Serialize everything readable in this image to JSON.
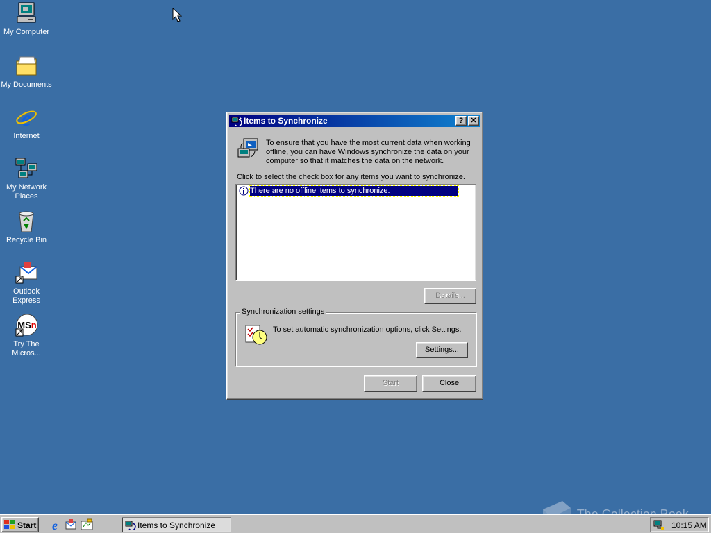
{
  "desktop": {
    "icons": [
      {
        "label": "My Computer"
      },
      {
        "label": "My Documents"
      },
      {
        "label": "Internet"
      },
      {
        "label": "My Network Places"
      },
      {
        "label": "Recycle Bin"
      },
      {
        "label": "Outlook Express"
      },
      {
        "label": "Try The Micros..."
      }
    ],
    "background_color": "#3a6ea5"
  },
  "dialog": {
    "title": "Items to Synchronize",
    "help_button": "?",
    "close_button": "✕",
    "description": "To ensure that you have the most current data when working offline, you can have Windows synchronize the data on your computer so that it matches the data on the network.",
    "instruction": "Click to select the check box for any items you want to synchronize.",
    "list_items": [
      {
        "label": "There are no offline items to synchronize.",
        "selected": true
      }
    ],
    "details_button": "Details...",
    "group": {
      "title": "Synchronization settings",
      "text": "To set automatic synchronization options, click Settings.",
      "settings_button": "Settings..."
    },
    "start_button": "Start",
    "close_label": "Close"
  },
  "taskbar": {
    "start_label": "Start",
    "task_label": "Items to Synchronize",
    "clock": "10:15 AM"
  },
  "watermark": "The Collection Book",
  "colors": {
    "title_active": "#000080",
    "selection": "#000080",
    "face": "#c0c0c0"
  }
}
